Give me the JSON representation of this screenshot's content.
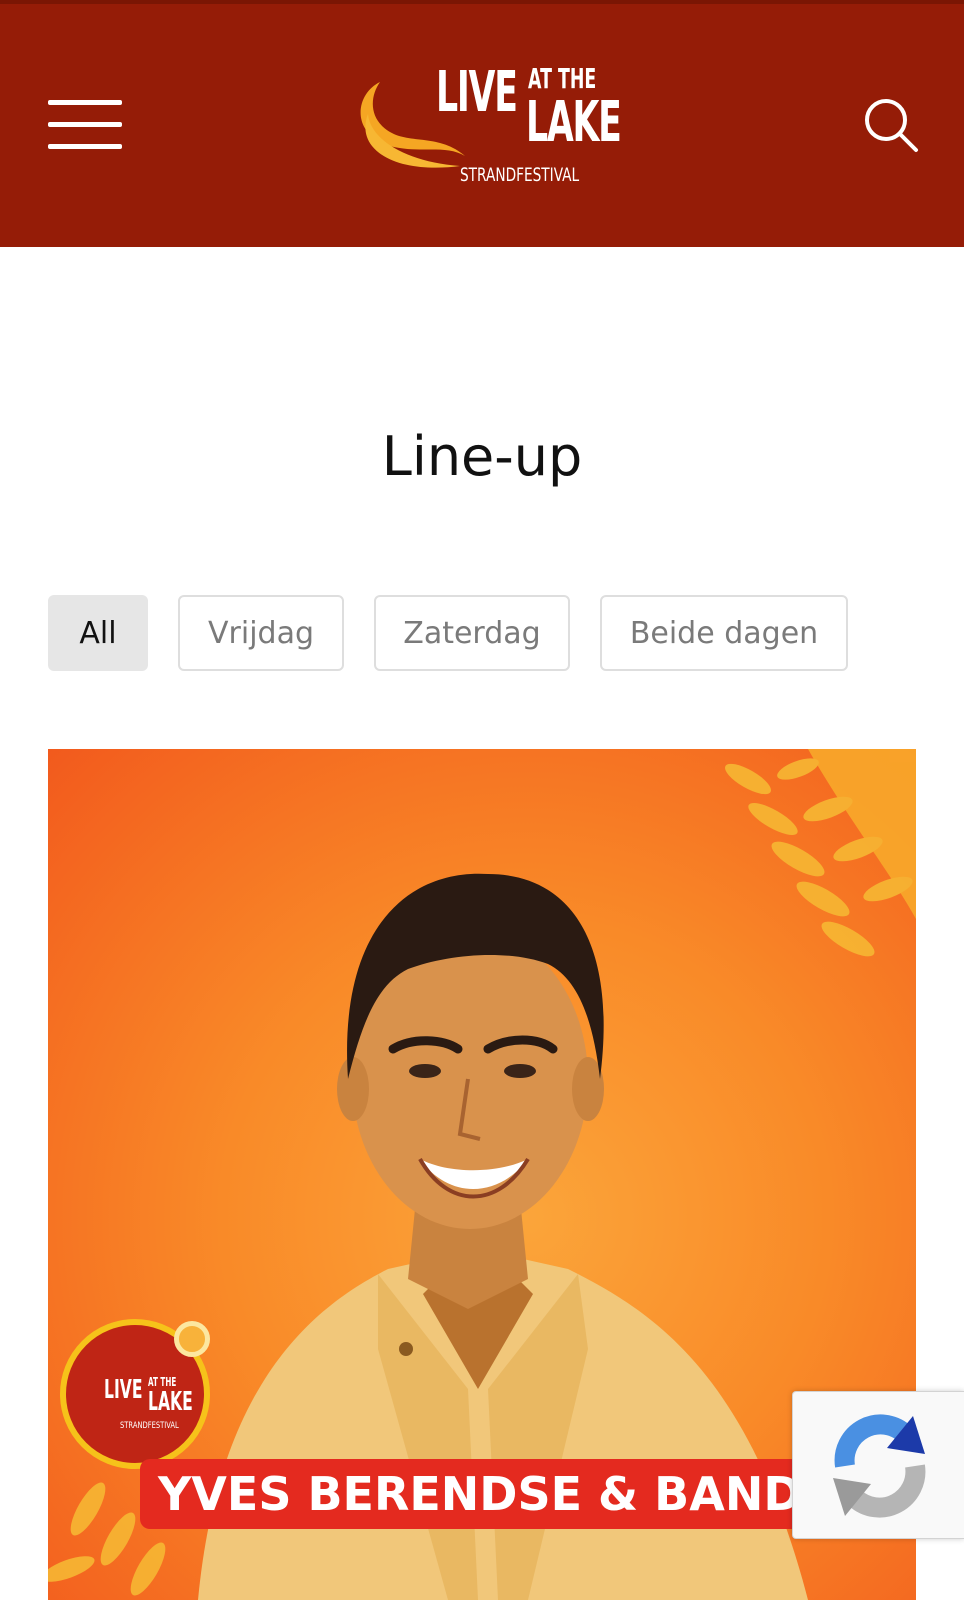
{
  "header": {
    "logo": {
      "line1": "LIVE",
      "line2": "AT THE",
      "line3": "LAKE",
      "tagline": "STRANDFESTIVAL"
    },
    "menu_icon": "hamburger-menu-icon",
    "search_icon": "search-icon",
    "background_color": "#951c07"
  },
  "main": {
    "title": "Line-up",
    "filters": [
      {
        "label": "All",
        "active": true
      },
      {
        "label": "Vrijdag",
        "active": false
      },
      {
        "label": "Zaterdag",
        "active": false
      },
      {
        "label": "Beide dagen",
        "active": false
      }
    ],
    "artist_card": {
      "name": "YVES BERENDSE & BAND",
      "badge": {
        "line1": "LIVE",
        "line2": "AT THE",
        "line3": "LAKE",
        "tagline": "STRANDFESTIVAL"
      }
    }
  },
  "recaptcha": {
    "icon": "recaptcha-icon"
  }
}
